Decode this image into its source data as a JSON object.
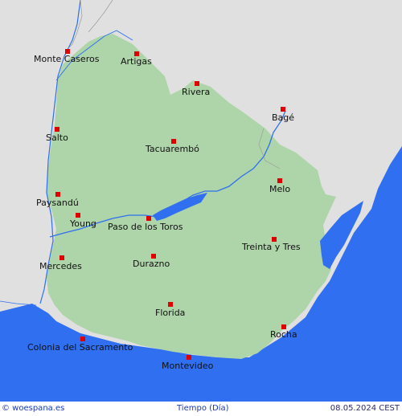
{
  "map": {
    "colors": {
      "sea": "#2f6ff0",
      "land": "#aed4a9",
      "neighbor": "#e0e0e0",
      "river": "#2f6ff0",
      "marker": "#e00000"
    }
  },
  "cities": [
    {
      "id": "monte-caseros",
      "name": "Monte Caseros"
    },
    {
      "id": "artigas",
      "name": "Artigas"
    },
    {
      "id": "rivera",
      "name": "Rivera"
    },
    {
      "id": "bage",
      "name": "Bagé"
    },
    {
      "id": "salto",
      "name": "Salto"
    },
    {
      "id": "tacuarembo",
      "name": "Tacuarembó"
    },
    {
      "id": "melo",
      "name": "Melo"
    },
    {
      "id": "paysandu",
      "name": "Paysandú"
    },
    {
      "id": "young",
      "name": "Young"
    },
    {
      "id": "paso-de-los-toros",
      "name": "Paso de los Toros"
    },
    {
      "id": "treinta-y-tres",
      "name": "Treinta y Tres"
    },
    {
      "id": "mercedes",
      "name": "Mercedes"
    },
    {
      "id": "durazno",
      "name": "Durazno"
    },
    {
      "id": "florida",
      "name": "Florida"
    },
    {
      "id": "rocha",
      "name": "Rocha"
    },
    {
      "id": "colonia-del-sacramento",
      "name": "Colonia del Sacramento"
    },
    {
      "id": "montevideo",
      "name": "Montevideo"
    }
  ],
  "footer": {
    "brand": "© woespana.es",
    "title": "Tiempo (Día)",
    "timestamp": "08.05.2024 CEST"
  }
}
